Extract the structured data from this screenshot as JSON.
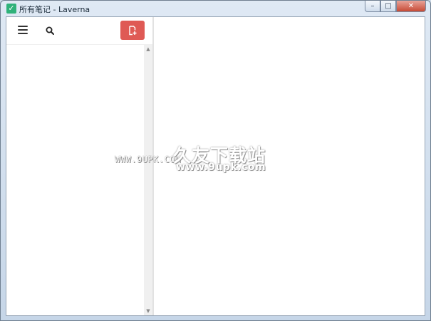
{
  "window": {
    "title": "所有笔记 - Laverna",
    "app_icon": "check-icon",
    "controls": {
      "minimize": "–",
      "maximize": "□",
      "close": "✕"
    }
  },
  "sidebar": {
    "menu_icon": "hamburger-menu-icon",
    "search_icon": "search-icon",
    "new_note_icon": "new-note-icon",
    "accent_color": "#df5a55"
  },
  "watermark": {
    "url_left": "WWW.9UPK.COM",
    "brand": "久友下载站",
    "url_right": "www.9upk.com"
  }
}
